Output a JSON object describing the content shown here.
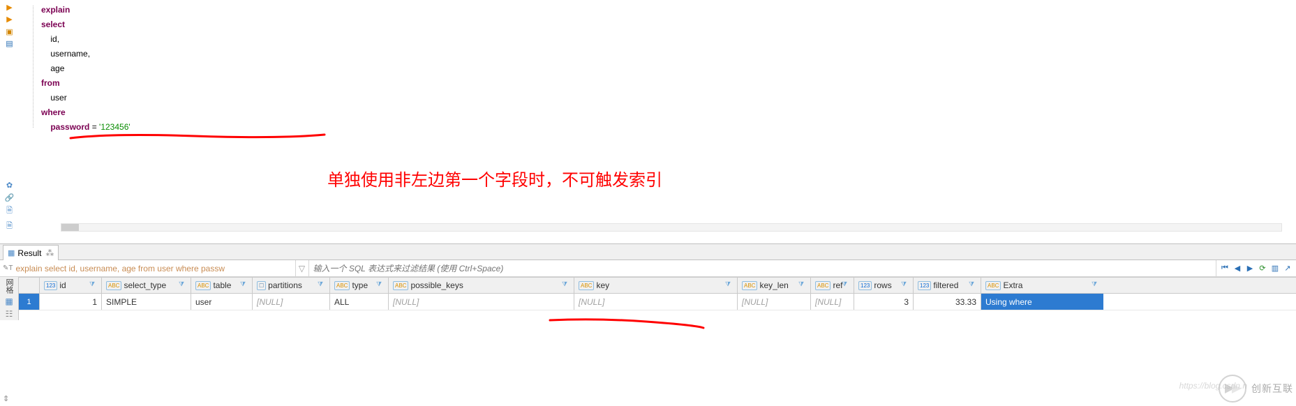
{
  "editor": {
    "code_tokens": [
      [
        [
          "kw",
          "explain"
        ]
      ],
      [
        [
          "kw",
          "select"
        ]
      ],
      [
        [
          "ind",
          "    "
        ],
        [
          "col",
          "id"
        ],
        [
          "col",
          ","
        ]
      ],
      [
        [
          "ind",
          "    "
        ],
        [
          "col",
          "username"
        ],
        [
          "col",
          ","
        ]
      ],
      [
        [
          "ind",
          "    "
        ],
        [
          "col",
          "age"
        ]
      ],
      [
        [
          "kw",
          "from"
        ]
      ],
      [
        [
          "ind",
          "    "
        ],
        [
          "col",
          "user"
        ]
      ],
      [
        [
          "kw",
          "where"
        ]
      ],
      [
        [
          "ind",
          "    "
        ],
        [
          "kw",
          "password"
        ],
        [
          "col",
          " = "
        ],
        [
          "str",
          "'123456'"
        ]
      ]
    ],
    "highlight_line_index": 4
  },
  "annotation": {
    "text": "单独使用非左边第一个字段时，不可触发索引"
  },
  "result_tab": {
    "label": "Result"
  },
  "filter_bar": {
    "query_preview": "explain select id, username, age from user where passw",
    "input_placeholder": "输入一个 SQL 表达式来过滤结果 (使用 Ctrl+Space)"
  },
  "grid": {
    "side_label": "网格",
    "columns": [
      {
        "key": "id",
        "label": "id",
        "type": "num"
      },
      {
        "key": "select_type",
        "label": "select_type",
        "type": "str"
      },
      {
        "key": "table",
        "label": "table",
        "type": "str"
      },
      {
        "key": "partitions",
        "label": "partitions",
        "type": "obj"
      },
      {
        "key": "type",
        "label": "type",
        "type": "str"
      },
      {
        "key": "possible_keys",
        "label": "possible_keys",
        "type": "str"
      },
      {
        "key": "key",
        "label": "key",
        "type": "str"
      },
      {
        "key": "key_len",
        "label": "key_len",
        "type": "str"
      },
      {
        "key": "ref",
        "label": "ref",
        "type": "str"
      },
      {
        "key": "rows",
        "label": "rows",
        "type": "num"
      },
      {
        "key": "filtered",
        "label": "filtered",
        "type": "num"
      },
      {
        "key": "Extra",
        "label": "Extra",
        "type": "str"
      }
    ],
    "rows": [
      {
        "n": "1",
        "id": "1",
        "select_type": "SIMPLE",
        "table": "user",
        "partitions": "[NULL]",
        "type": "ALL",
        "possible_keys": "[NULL]",
        "key": "[NULL]",
        "key_len": "[NULL]",
        "ref": "[NULL]",
        "rows": "3",
        "filtered": "33.33",
        "Extra": "Using where"
      }
    ]
  },
  "watermark": {
    "brand": "创新互联"
  }
}
